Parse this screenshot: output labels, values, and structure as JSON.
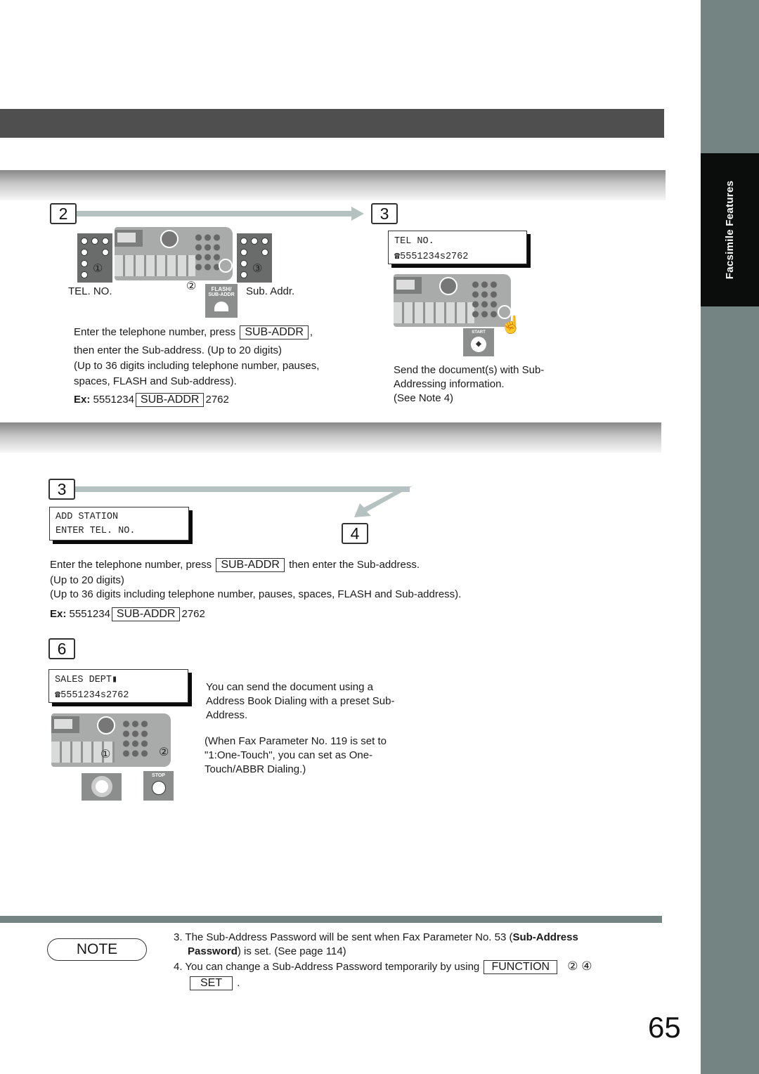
{
  "side_tab": {
    "label": "Facsimile Features"
  },
  "section_a": {
    "step2": {
      "number": "2",
      "labels": {
        "tel_no": "TEL. NO.",
        "sub_addr": "Sub. Addr."
      },
      "finger_marks": [
        "①",
        "②",
        "③"
      ],
      "flash_button": "FLASH/\nSUB-ADDR",
      "flash_line1": "FLASH/",
      "flash_line2": "SUB-ADDR",
      "text_line1": "Enter the telephone number, press",
      "key": "SUB-ADDR",
      "text_line1_end": ",",
      "text_line2": "then enter the Sub-address. (Up to 20 digits)",
      "text_line3": "(Up to 36 digits including telephone number, pauses,",
      "text_line4": "spaces, FLASH and Sub-address).",
      "ex_label": "Ex:",
      "ex_number": "5551234",
      "ex_key": "SUB-ADDR",
      "ex_sub": "2762"
    },
    "step3": {
      "number": "3",
      "lcd_line1": "TEL NO.",
      "lcd_line2": "☎5551234s2762",
      "start_label": "START",
      "text_line1": "Send the document(s) with Sub-",
      "text_line2": "Addressing information.",
      "text_line3": "(See Note 4)"
    }
  },
  "section_b": {
    "step3": {
      "number": "3",
      "lcd_line1": "ADD STATION",
      "lcd_line2": "ENTER TEL. NO."
    },
    "step4": {
      "number": "4",
      "text_line1_a": "Enter the telephone number, press",
      "key": "SUB-ADDR",
      "text_line1_b": "then enter the Sub-address.",
      "text_line2": "(Up to 20 digits)",
      "text_line3": "(Up to 36 digits including telephone number, pauses, spaces, FLASH and Sub-address).",
      "ex_label": "Ex:",
      "ex_number": "5551234",
      "ex_key": "SUB-ADDR",
      "ex_sub": "2762"
    },
    "step6": {
      "number": "6",
      "lcd_line1": "SALES DEPT▮",
      "lcd_line2": "☎5551234s2762",
      "finger_marks": [
        "①",
        "②"
      ],
      "stop_label": "STOP",
      "text_line1": "You can send the document using a",
      "text_line2": "Address Book Dialing with a preset Sub-",
      "text_line3": "Address.",
      "text_line4": "(When Fax Parameter No. 119 is set to",
      "text_line5": "\"1:One-Touch\", you can set as One-",
      "text_line6": "Touch/ABBR Dialing.)"
    }
  },
  "note": {
    "badge": "NOTE",
    "item3_num": "3.",
    "item3_a": "The Sub-Address Password will be sent when Fax Parameter No. 53 (",
    "item3_bold": "Sub-Address",
    "item3_bold2": "Password",
    "item3_b": ") is set. (See page 114)",
    "item4_num": "4.",
    "item4_a": "You can change a Sub-Address Password temporarily by using",
    "item4_key1": "FUNCTION",
    "item4_circles": "②  ④",
    "item4_key2": "SET",
    "item4_end": "."
  },
  "page_number": "65",
  "colors": {
    "side_strip": "#738483",
    "side_tab": "#0b0c0c",
    "title_bar": "#4f4f4f",
    "arrow": "#b6c2c1"
  }
}
